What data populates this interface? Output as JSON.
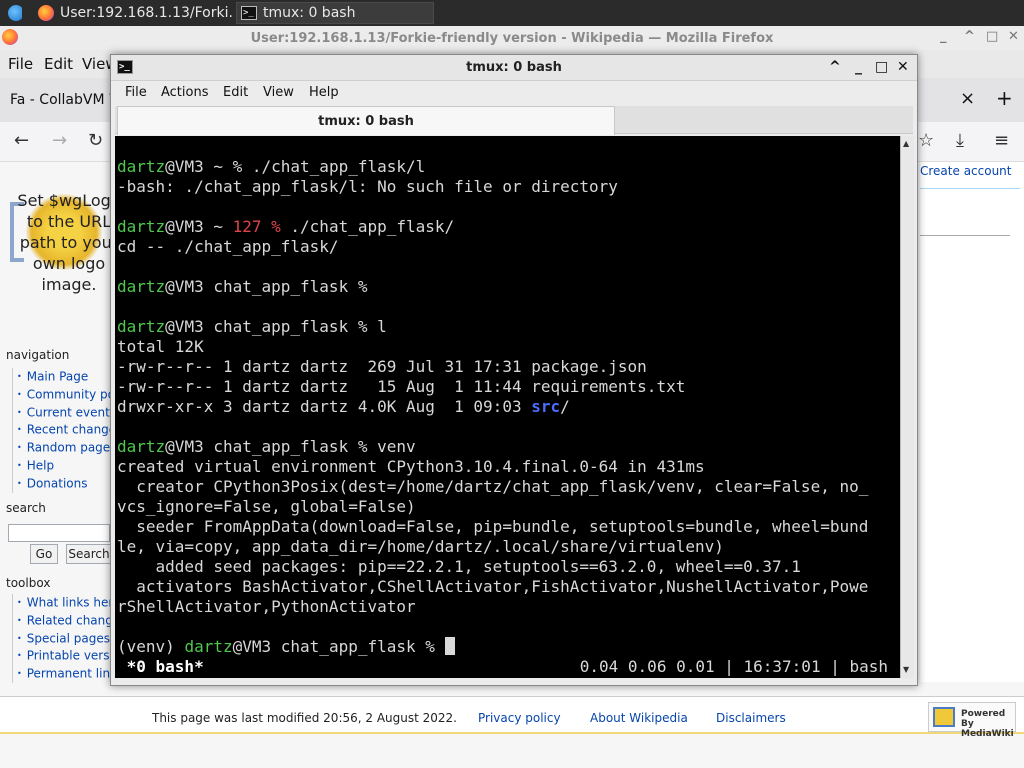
{
  "taskbar": {
    "firefox_task": "User:192.168.1.13/Forki...",
    "terminal_task": "tmux: 0 bash"
  },
  "firefox": {
    "window_title": "User:192.168.1.13/Forkie-friendly version - Wikipedia — Mozilla Firefox",
    "menu": [
      "File",
      "Edit",
      "View"
    ],
    "tab_label": "Fa - CollabVM W",
    "tab_close": "×",
    "new_tab": "+",
    "create_account": "Create account"
  },
  "wiki": {
    "logo_text": "Set $wgLogo to the URL path to your own logo image.",
    "navigation_title": "navigation",
    "navigation": [
      "Main Page",
      "Community portal",
      "Current events",
      "Recent changes",
      "Random page",
      "Help",
      "Donations"
    ],
    "search_title": "search",
    "go_button": "Go",
    "search_button": "Search",
    "toolbox_title": "toolbox",
    "toolbox": [
      "What links here",
      "Related changes",
      "Special pages",
      "Printable version",
      "Permanent link"
    ],
    "footer_modified": "This page was last modified 20:56, 2 August 2022.",
    "footer_privacy": "Privacy policy",
    "footer_about": "About Wikipedia",
    "footer_disclaimers": "Disclaimers",
    "mediawiki_badge": "Powered By MediaWiki"
  },
  "terminal": {
    "window_title": "tmux: 0 bash",
    "menu": [
      "File",
      "Actions",
      "Edit",
      "View",
      "Help"
    ],
    "tab_title": "tmux: 0 bash",
    "lines": [
      {
        "user": "dartz",
        "host": "@VM3 ~ ",
        "code": "",
        "rest": "% ./chat_app_flask/l"
      },
      {
        "text": "-bash: ./chat_app_flask/l: No such file or directory"
      },
      {
        "text": ""
      },
      {
        "user": "dartz",
        "host": "@VM3 ~ ",
        "code": "127 % ",
        "rest": "./chat_app_flask/"
      },
      {
        "text": "cd -- ./chat_app_flask/"
      },
      {
        "text": ""
      },
      {
        "user": "dartz",
        "host": "@VM3 chat_app_flask ",
        "code": "",
        "rest": "%"
      },
      {
        "text": ""
      },
      {
        "user": "dartz",
        "host": "@VM3 chat_app_flask ",
        "code": "",
        "rest": "% l"
      },
      {
        "text": "total 12K"
      },
      {
        "text": "-rw-r--r-- 1 dartz dartz  269 Jul 31 17:31 package.json"
      },
      {
        "text": "-rw-r--r-- 1 dartz dartz   15 Aug  1 11:44 requirements.txt"
      },
      {
        "text": "drwxr-xr-x 3 dartz dartz 4.0K Aug  1 09:03 ",
        "dir": "src",
        "after": "/"
      },
      {
        "text": ""
      },
      {
        "user": "dartz",
        "host": "@VM3 chat_app_flask ",
        "code": "",
        "rest": "% venv"
      },
      {
        "text": "created virtual environment CPython3.10.4.final.0-64 in 431ms"
      },
      {
        "text": "  creator CPython3Posix(dest=/home/dartz/chat_app_flask/venv, clear=False, no_"
      },
      {
        "text": "vcs_ignore=False, global=False)"
      },
      {
        "text": "  seeder FromAppData(download=False, pip=bundle, setuptools=bundle, wheel=bund"
      },
      {
        "text": "le, via=copy, app_data_dir=/home/dartz/.local/share/virtualenv)"
      },
      {
        "text": "    added seed packages: pip==22.2.1, setuptools==63.2.0, wheel==0.37.1"
      },
      {
        "text": "  activators BashActivator,CShellActivator,FishActivator,NushellActivator,Powe"
      },
      {
        "text": "rShellActivator,PythonActivator"
      },
      {
        "text": ""
      }
    ],
    "prompt": {
      "venv": "(venv) ",
      "user": "dartz",
      "host": "@VM3 chat_app_flask ",
      "rest": "% "
    },
    "status_left": " *0 bash*",
    "status_right": "0.04 0.06 0.01 | 16:37:01 | bash"
  }
}
